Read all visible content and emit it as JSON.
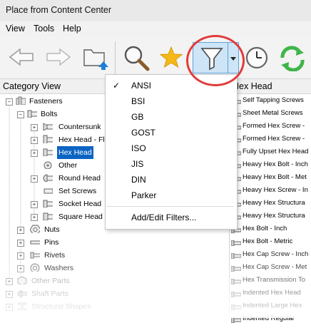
{
  "window": {
    "title": "Place from Content Center"
  },
  "menu": [
    "View",
    "Tools",
    "Help"
  ],
  "toolbar": {
    "icons": [
      "back-arrow-icon",
      "forward-arrow-icon",
      "folder-up-icon",
      "search-icon",
      "favorite-star-icon",
      "filter-icon",
      "dropdown-arrow-icon",
      "history-clock-icon",
      "refresh-icon"
    ],
    "filter_active": true
  },
  "category_view": {
    "header": "Category View",
    "tree": [
      {
        "label": "Fasteners"
      },
      {
        "label": "Bolts"
      },
      {
        "label": "Countersunk"
      },
      {
        "label": "Hex Head - Fla"
      },
      {
        "label": "Hex Head",
        "selected": true
      },
      {
        "label": "Other"
      },
      {
        "label": "Round Head"
      },
      {
        "label": "Set Screws"
      },
      {
        "label": "Socket Head"
      },
      {
        "label": "Square Head"
      },
      {
        "label": "Nuts"
      },
      {
        "label": "Pins"
      },
      {
        "label": "Rivets"
      },
      {
        "label": "Washers"
      },
      {
        "label": "Other Parts"
      },
      {
        "label": "Shaft Parts"
      },
      {
        "label": "Structural Shapes"
      }
    ]
  },
  "results": {
    "header": "Hex Head",
    "items": [
      "Self Tapping Screws",
      "Sheet Metal Screws",
      "Formed Hex Screw -",
      "Formed Hex Screw -",
      "Fully Upset Hex Head",
      "Heavy Hex Bolt - Inch",
      "Heavy Hex Bolt - Met",
      "Heavy Hex Screw - In",
      "Heavy Hex Structura",
      "Heavy Hex Structura",
      "Hex Bolt - Inch",
      "Hex Bolt - Metric",
      "Hex Cap Screw - Inch",
      "Hex Cap Screw - Met",
      "Hex Transmission To",
      "Indented Hex Head",
      "Indented Large Hex",
      "Indented Regular"
    ]
  },
  "filter_menu": {
    "items": [
      {
        "label": "ANSI",
        "checked": true
      },
      {
        "label": "BSI"
      },
      {
        "label": "GB"
      },
      {
        "label": "GOST"
      },
      {
        "label": "ISO"
      },
      {
        "label": "JIS"
      },
      {
        "label": "DIN"
      },
      {
        "label": "Parker"
      }
    ],
    "check_mark": "✓",
    "footer": "Add/Edit Filters..."
  },
  "colors": {
    "accent": "#0a64c2",
    "highlight_ring": "#e23b3b",
    "filter_button": "#cde5f7"
  }
}
